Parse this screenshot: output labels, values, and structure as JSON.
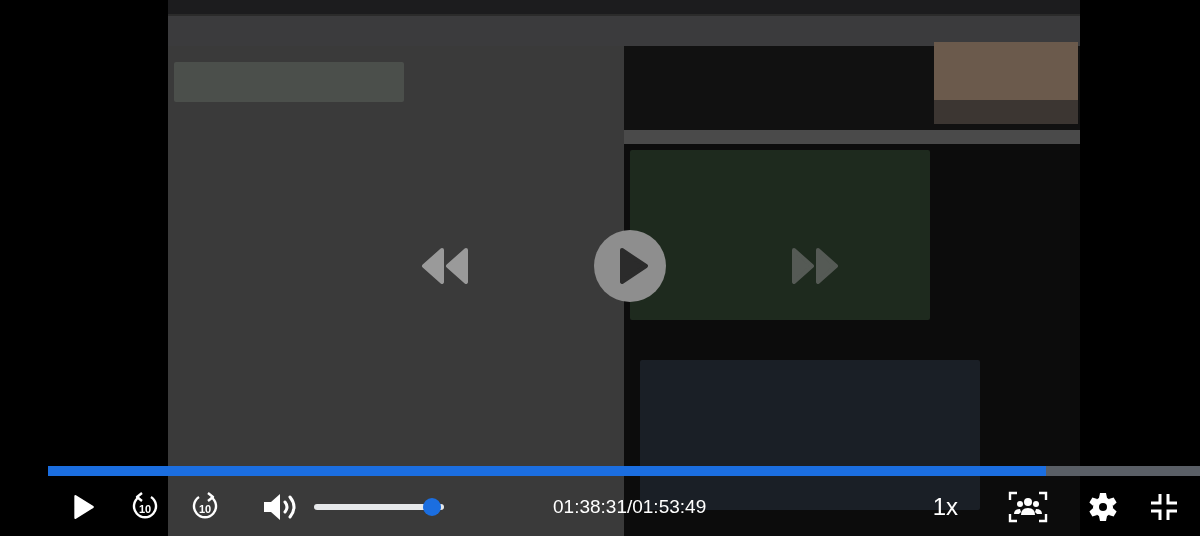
{
  "player": {
    "playing": false
  },
  "progress": {
    "level": 0.866
  },
  "volume": {
    "level": 0.9
  },
  "time": "01:38:31/01:53:49",
  "speed": "1x",
  "skip_back_label": "10",
  "skip_forward_label": "10"
}
